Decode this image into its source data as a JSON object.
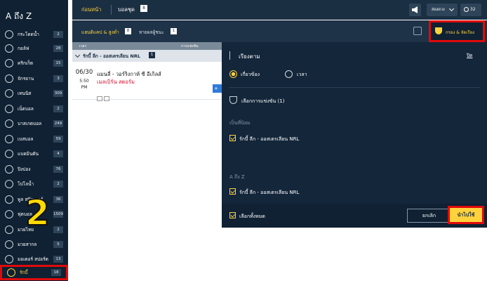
{
  "sidebar": {
    "title": "A ถึง Z",
    "items": [
      {
        "label": "กระโดดน้ำ",
        "count": "2",
        "icon": "diving-icon"
      },
      {
        "label": "กอล์ฟ",
        "count": "28",
        "icon": "golf-icon"
      },
      {
        "label": "คริกเก็ต",
        "count": "15",
        "icon": "cricket-icon"
      },
      {
        "label": "จักรยาน",
        "count": "3",
        "icon": "cycling-icon"
      },
      {
        "label": "เทนนิส",
        "count": "309",
        "icon": "tennis-icon"
      },
      {
        "label": "เน็ตบอล",
        "count": "2",
        "icon": "netball-icon"
      },
      {
        "label": "บาสเกตบอล",
        "count": "249",
        "icon": "basketball-icon"
      },
      {
        "label": "เบสบอล",
        "count": "59",
        "icon": "baseball-icon"
      },
      {
        "label": "แบดมินตัน",
        "count": "4",
        "icon": "badminton-icon"
      },
      {
        "label": "ปิงปอง",
        "count": "76",
        "icon": "table-tennis-icon"
      },
      {
        "label": "โปโลน้ำ",
        "count": "2",
        "icon": "water-polo-icon"
      },
      {
        "label": "พูล สนุ๊กเกอร์",
        "count": "36",
        "icon": "pool-icon"
      },
      {
        "label": "ฟุตบอล",
        "count": "1509",
        "icon": "soccer-icon"
      },
      {
        "label": "มวยไทย",
        "count": "2",
        "icon": "muay-thai-icon"
      },
      {
        "label": "มวยสากล",
        "count": "5",
        "icon": "boxing-icon"
      },
      {
        "label": "มอเตอร์ สปอร์ต",
        "count": "13",
        "icon": "motorsport-icon"
      },
      {
        "label": "รักบี้",
        "count": "18",
        "icon": "rugby-icon"
      }
    ],
    "step_number": "2"
  },
  "topbar": {
    "tab_before": "ก่อนหน้า",
    "tab_ball": "บอลชุด",
    "tab_ball_count": "8",
    "lang_label": "ส่องดวง",
    "timer_value": "32"
  },
  "subbar": {
    "tab1": "แฮนดิแคป & สูงต่ำ",
    "tab1_count": "8",
    "tab2": "หายผลผู้ชนะ",
    "tab2_count": "1",
    "filter_label": "กรอง & จัดเรียง"
  },
  "table": {
    "header_time": "เวลา",
    "header_comp": "การแข่งขัน",
    "group_name": "รักบี้ ลีก - ออสเตรเลียน NRL",
    "group_count": "1",
    "match": {
      "date": "06/30",
      "time": "5:50",
      "ampm": "PM",
      "team1": "แมนลี่ - วอร์ริงกาห์ ซี อีเกิลส์",
      "team2": "เมลเบิร์น สตอร์ม",
      "plus": "+"
    }
  },
  "panel": {
    "sort_title": "เรียงตาม",
    "close": "ปิด",
    "sort_options": [
      {
        "label": "เกี่ยวข้อง",
        "selected": true
      },
      {
        "label": "เวลา",
        "selected": false
      }
    ],
    "comp_select": "เลือกการแข่งขัน (1)",
    "popular_heading": "เป็นที่นิยม",
    "popular_items": [
      "รักบี้ ลีก - ออสเตรเลียน NRL"
    ],
    "az_heading": "A ถึง Z",
    "az_items": [
      "รักบี้ ลีก - ออสเตรเลียน NRL"
    ],
    "select_all": "เลือกทั้งหมด",
    "cancel": "ยกเลิก",
    "apply": "นำไปใช้"
  },
  "colors": {
    "accent": "#ffd23d",
    "highlight": "#e00a0a",
    "navy": "#13263a"
  }
}
